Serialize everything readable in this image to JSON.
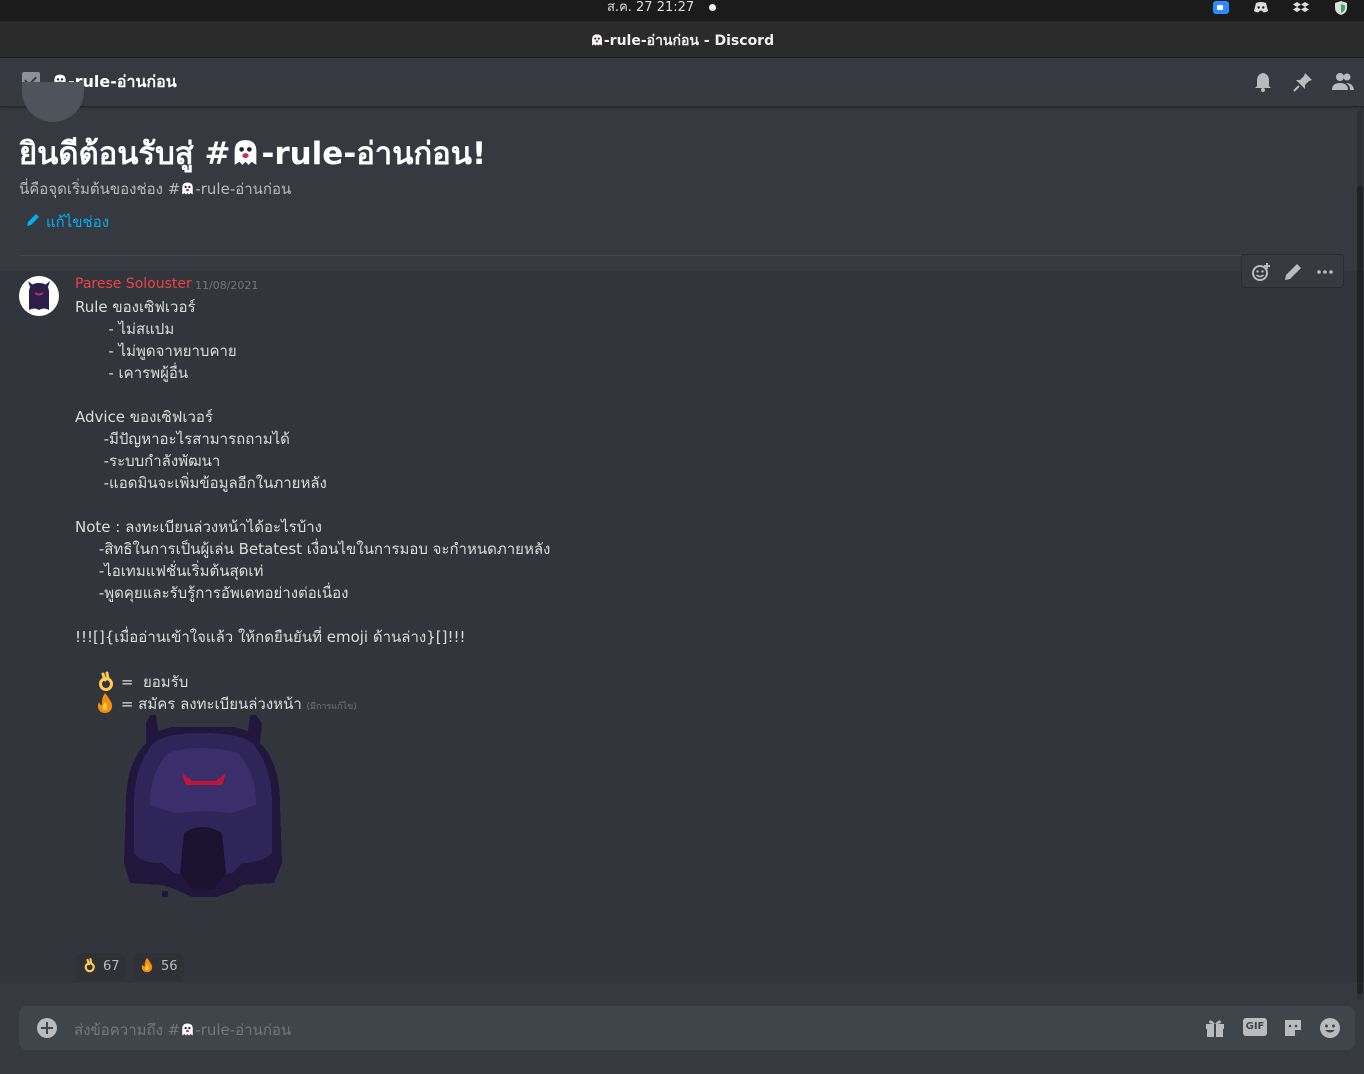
{
  "system_bar": {
    "clock": "ส.ค. 27  21:27"
  },
  "window": {
    "title": "-rule-อ่านก่อน - Discord"
  },
  "channel_header": {
    "channel_name": "-rule-อ่านก่อน"
  },
  "welcome": {
    "title_prefix": "ยินดีต้อนรับสู่ #",
    "title_suffix": "-rule-อ่านก่อน!",
    "subtitle_prefix": "นี่คือจุดเริ่มต้นของช่อง #",
    "subtitle_suffix": "-rule-อ่านก่อน",
    "edit_channel": "แก้ไขช่อง"
  },
  "message": {
    "author": "Parese Solouster",
    "timestamp": "11/08/2021",
    "lines": [
      "Rule ของเซิฟเวอร์",
      "       - ไม่สแปม",
      "       - ไม่พูดจาหยาบคาย",
      "       - เคารพผู้อื่น",
      "",
      "Advice ของเซิฟเวอร์",
      "      -มีปัญหาอะไรสามารถถามได้",
      "      -ระบบกำลังพัฒนา",
      "      -แอดมินจะเพิ่มข้อมูลอีกในภายหลัง",
      "",
      "Note : ลงทะเบียนล่วงหน้าได้อะไรบ้าง",
      "     -สิทธิในการเป็นผู้เล่น Betatest เงื่อนไขในการมอบ จะกำหนดภายหลัง",
      "     -ไอเทมแฟชั่นเริ่มต้นสุดเท่",
      "     -พูดคุยและรับรู้การอัพเดทอย่างต่อเนื่อง",
      "",
      "!!![]{เมื่ออ่านเข้าใจแล้ว ให้กดยืนยันที่ emoji ด้านล่าง}[]!!!"
    ],
    "emoji_line_1": " =  ยอมรับ",
    "emoji_line_2": " = สมัคร ลงทะเบียนล่วงหน้า",
    "edited_tag": "(มีการแก้ไข)"
  },
  "reactions": [
    {
      "emoji": "ok-hand",
      "count": "67"
    },
    {
      "emoji": "fire",
      "count": "56"
    }
  ],
  "composer": {
    "placeholder_prefix": "ส่งข้อความถึง #",
    "placeholder_suffix": "-rule-อ่านก่อน",
    "gif_label": "GIF"
  },
  "colors": {
    "background": "#36393f",
    "author": "#ed4245",
    "link": "#00aff4"
  }
}
